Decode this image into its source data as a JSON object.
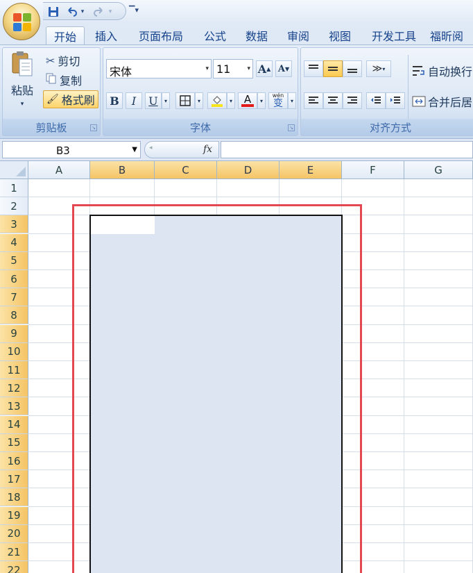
{
  "quick_access": {
    "icons": [
      "save-icon",
      "undo-icon",
      "redo-icon",
      "customize-icon"
    ]
  },
  "tabs": [
    "开始",
    "插入",
    "页面布局",
    "公式",
    "数据",
    "审阅",
    "视图",
    "开发工具",
    "福昕阅"
  ],
  "active_tab": "开始",
  "clipboard": {
    "paste_label": "粘贴",
    "cut_label": "剪切",
    "copy_label": "复制",
    "format_painter_label": "格式刷",
    "group_label": "剪贴板"
  },
  "font": {
    "font_name": "宋体",
    "font_size": "11",
    "grow_label": "A",
    "shrink_label": "A",
    "bold_label": "B",
    "italic_label": "I",
    "underline_label": "U",
    "font_color_label": "A",
    "phonetic_label": "wén",
    "phonetic_char": "变",
    "group_label": "字体"
  },
  "alignment": {
    "wrap_text_label": "自动换行",
    "merge_center_label": "合并后居",
    "group_label": "对齐方式"
  },
  "formula_bar": {
    "name_box": "B3",
    "fx": "fx",
    "content": ""
  },
  "columns": [
    "A",
    "B",
    "C",
    "D",
    "E",
    "F",
    "G"
  ],
  "selected_columns": [
    "B",
    "C",
    "D",
    "E"
  ],
  "rows": [
    "1",
    "2",
    "3",
    "4",
    "5",
    "6",
    "7",
    "8",
    "9",
    "10",
    "11",
    "12",
    "13",
    "14",
    "15",
    "16",
    "17",
    "18",
    "19",
    "20",
    "21",
    "22"
  ],
  "selected_rows_from": 3,
  "colors": {
    "selection_fill": "#dde5f2",
    "highlight_frame": "#e3474f",
    "selected_header": "#f5c465"
  }
}
